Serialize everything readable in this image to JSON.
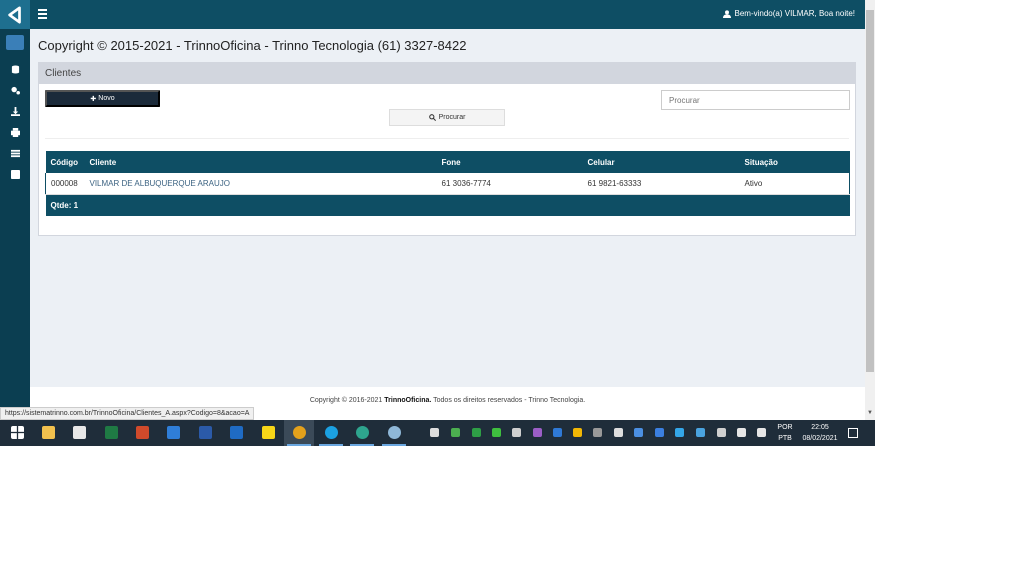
{
  "topbar": {
    "welcome": "Bem-vindo(a) VILMAR, Boa noite!"
  },
  "page": {
    "title": "Copyright © 2015-2021 - TrinnoOficina - Trinno Tecnologia (61) 3327-8422"
  },
  "panel": {
    "header": "Clientes",
    "new_label": "Novo",
    "search_placeholder": "Procurar",
    "search_button": "Procurar"
  },
  "table": {
    "headers": [
      "Código",
      "Cliente",
      "Fone",
      "Celular",
      "Situação"
    ],
    "rows": [
      {
        "codigo": "000008",
        "cliente": "VILMAR DE ALBUQUERQUE ARAUJO",
        "fone": "61 3036-7774",
        "celular": "61 9821-63333",
        "situacao": "Ativo"
      }
    ],
    "footer": "Qtde: 1"
  },
  "footer": {
    "prefix": "Copyright © 2016-2021 ",
    "brand": "TrinnoOficina.",
    "suffix": " Todos os direitos reservados - Trinno Tecnologia."
  },
  "status_url": "https://sistematrinno.com.br/TrinnoOficina/Clientes_A.aspx?Codigo=8&acao=A",
  "taskbar": {
    "lang_top": "POR",
    "lang_bottom": "PTB",
    "time": "22:05",
    "date": "08/02/2021"
  },
  "colors": {
    "topbar": "#0e4e64",
    "sidebar": "#0b3e51",
    "primary_button": "#1b2a3a"
  }
}
